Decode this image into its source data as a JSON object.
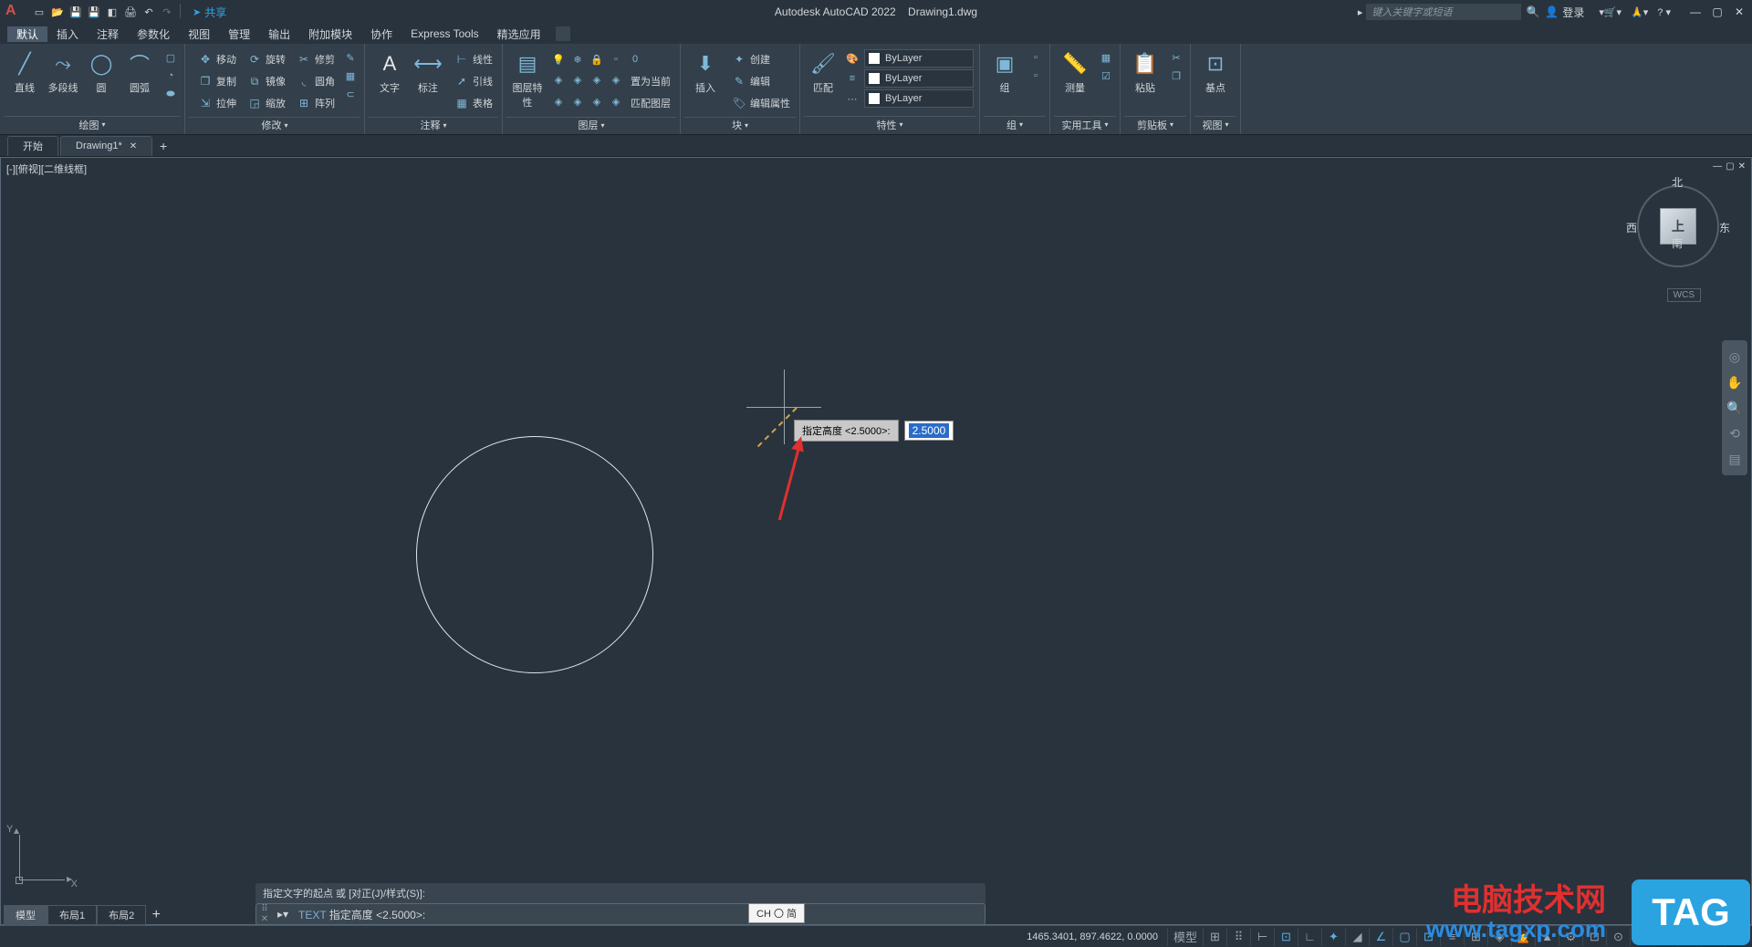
{
  "title": {
    "app": "Autodesk AutoCAD 2022",
    "file": "Drawing1.dwg"
  },
  "share": "共享",
  "search_placeholder": "键入关键字或短语",
  "login": "登录",
  "menus": [
    "默认",
    "插入",
    "注释",
    "参数化",
    "视图",
    "管理",
    "输出",
    "附加模块",
    "协作",
    "Express Tools",
    "精选应用"
  ],
  "panels": {
    "draw": {
      "label": "绘图",
      "line": "直线",
      "pline": "多段线",
      "circle": "圆",
      "arc": "圆弧"
    },
    "modify": {
      "label": "修改",
      "move": "移动",
      "rotate": "旋转",
      "trim": "修剪",
      "copy": "复制",
      "mirror": "镜像",
      "fillet": "圆角",
      "stretch": "拉伸",
      "scale": "缩放",
      "array": "阵列"
    },
    "annotation": {
      "label": "注释",
      "text": "文字",
      "dim": "标注",
      "table": "表格",
      "linear": "线性",
      "leader": "引线"
    },
    "layers": {
      "label": "图层",
      "layerprop": "图层特性",
      "setcurrent": "置为当前",
      "match": "匹配图层"
    },
    "block": {
      "label": "块",
      "insert": "插入",
      "create": "创建",
      "edit": "编辑",
      "attr": "编辑属性"
    },
    "properties": {
      "label": "特性",
      "props": "特性",
      "match": "匹配",
      "bylayer": "ByLayer"
    },
    "groups": {
      "label": "组",
      "group": "组"
    },
    "utilities": {
      "label": "实用工具",
      "measure": "测量"
    },
    "clipboard": {
      "label": "剪贴板",
      "paste": "粘贴"
    },
    "view": {
      "label": "视图",
      "base": "基点"
    }
  },
  "tabs": {
    "start": "开始",
    "drawing": "Drawing1*"
  },
  "viewport": {
    "label": "[-][俯视][二维线框]"
  },
  "viewcube": {
    "top": "上",
    "n": "北",
    "s": "南",
    "e": "东",
    "w": "西",
    "wcs": "WCS"
  },
  "ucs": {
    "x": "X",
    "y": "Y"
  },
  "tooltip": {
    "label": "指定高度 <2.5000>:",
    "value": "2.5000"
  },
  "cmdline": {
    "history": "指定文字的起点 或 [对正(J)/样式(S)]:",
    "cmd": "TEXT",
    "prompt": "指定高度 <2.5000>:"
  },
  "layouts": {
    "model": "模型",
    "l1": "布局1",
    "l2": "布局2"
  },
  "status": {
    "coords": "1465.3401, 897.4622, 0.0000",
    "model": "模型",
    "ime": "CH 〇 简"
  },
  "watermark": {
    "t1": "电脑技术网",
    "t2": "www.tagxp.com",
    "tag": "TAG"
  }
}
